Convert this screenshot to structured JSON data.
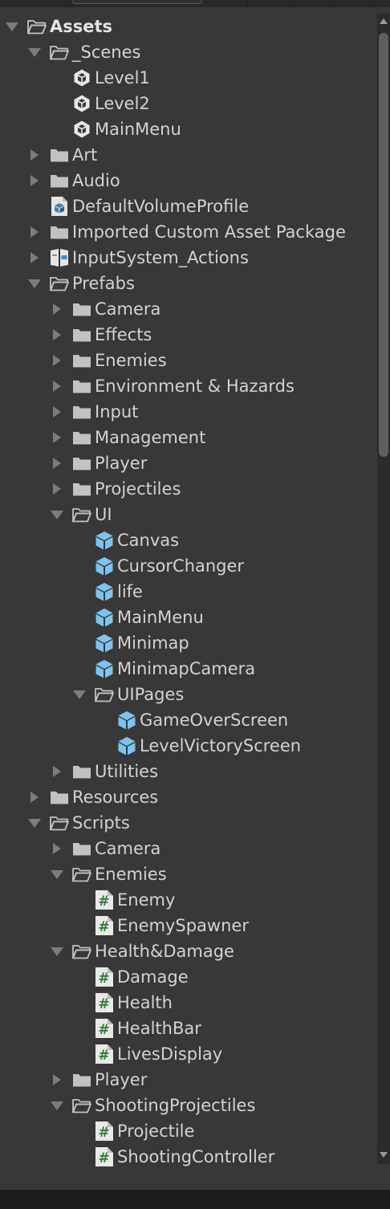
{
  "project_tree": {
    "items": [
      {
        "label": "Assets",
        "depth": 0,
        "icon": "folder-open-icon",
        "expand": "expanded",
        "bold": true
      },
      {
        "label": "_Scenes",
        "depth": 1,
        "icon": "folder-open-icon",
        "expand": "expanded"
      },
      {
        "label": "Level1",
        "depth": 2,
        "icon": "unity-scene-icon",
        "expand": "none"
      },
      {
        "label": "Level2",
        "depth": 2,
        "icon": "unity-scene-icon",
        "expand": "none"
      },
      {
        "label": "MainMenu",
        "depth": 2,
        "icon": "unity-scene-icon",
        "expand": "none"
      },
      {
        "label": "Art",
        "depth": 1,
        "icon": "folder-icon",
        "expand": "collapsed"
      },
      {
        "label": "Audio",
        "depth": 1,
        "icon": "folder-icon",
        "expand": "collapsed"
      },
      {
        "label": "DefaultVolumeProfile",
        "depth": 1,
        "icon": "volume-profile-icon",
        "expand": "none"
      },
      {
        "label": "Imported Custom Asset Package",
        "depth": 1,
        "icon": "folder-icon",
        "expand": "collapsed"
      },
      {
        "label": "InputSystem_Actions",
        "depth": 1,
        "icon": "input-actions-icon",
        "expand": "collapsed"
      },
      {
        "label": "Prefabs",
        "depth": 1,
        "icon": "folder-open-icon",
        "expand": "expanded"
      },
      {
        "label": "Camera",
        "depth": 2,
        "icon": "folder-icon",
        "expand": "collapsed"
      },
      {
        "label": "Effects",
        "depth": 2,
        "icon": "folder-icon",
        "expand": "collapsed"
      },
      {
        "label": "Enemies",
        "depth": 2,
        "icon": "folder-icon",
        "expand": "collapsed"
      },
      {
        "label": "Environment & Hazards",
        "depth": 2,
        "icon": "folder-icon",
        "expand": "collapsed"
      },
      {
        "label": "Input",
        "depth": 2,
        "icon": "folder-icon",
        "expand": "collapsed"
      },
      {
        "label": "Management",
        "depth": 2,
        "icon": "folder-icon",
        "expand": "collapsed"
      },
      {
        "label": "Player",
        "depth": 2,
        "icon": "folder-icon",
        "expand": "collapsed"
      },
      {
        "label": "Projectiles",
        "depth": 2,
        "icon": "folder-icon",
        "expand": "collapsed"
      },
      {
        "label": "UI",
        "depth": 2,
        "icon": "folder-open-icon",
        "expand": "expanded"
      },
      {
        "label": "Canvas",
        "depth": 3,
        "icon": "prefab-icon",
        "expand": "none"
      },
      {
        "label": "CursorChanger",
        "depth": 3,
        "icon": "prefab-icon",
        "expand": "none"
      },
      {
        "label": "life",
        "depth": 3,
        "icon": "prefab-icon",
        "expand": "none"
      },
      {
        "label": "MainMenu",
        "depth": 3,
        "icon": "prefab-icon",
        "expand": "none"
      },
      {
        "label": "Minimap",
        "depth": 3,
        "icon": "prefab-icon",
        "expand": "none"
      },
      {
        "label": "MinimapCamera",
        "depth": 3,
        "icon": "prefab-icon",
        "expand": "none"
      },
      {
        "label": "UIPages",
        "depth": 3,
        "icon": "folder-open-icon",
        "expand": "expanded"
      },
      {
        "label": "GameOverScreen",
        "depth": 4,
        "icon": "prefab-icon",
        "expand": "none"
      },
      {
        "label": "LevelVictoryScreen",
        "depth": 4,
        "icon": "prefab-icon",
        "expand": "none"
      },
      {
        "label": "Utilities",
        "depth": 2,
        "icon": "folder-icon",
        "expand": "collapsed"
      },
      {
        "label": "Resources",
        "depth": 1,
        "icon": "folder-icon",
        "expand": "collapsed"
      },
      {
        "label": "Scripts",
        "depth": 1,
        "icon": "folder-open-icon",
        "expand": "expanded"
      },
      {
        "label": "Camera",
        "depth": 2,
        "icon": "folder-icon",
        "expand": "collapsed"
      },
      {
        "label": "Enemies",
        "depth": 2,
        "icon": "folder-open-icon",
        "expand": "expanded"
      },
      {
        "label": "Enemy",
        "depth": 3,
        "icon": "csharp-script-icon",
        "expand": "none"
      },
      {
        "label": "EnemySpawner",
        "depth": 3,
        "icon": "csharp-script-icon",
        "expand": "none"
      },
      {
        "label": "Health&Damage",
        "depth": 2,
        "icon": "folder-open-icon",
        "expand": "expanded"
      },
      {
        "label": "Damage",
        "depth": 3,
        "icon": "csharp-script-icon",
        "expand": "none"
      },
      {
        "label": "Health",
        "depth": 3,
        "icon": "csharp-script-icon",
        "expand": "none"
      },
      {
        "label": "HealthBar",
        "depth": 3,
        "icon": "csharp-script-icon",
        "expand": "none"
      },
      {
        "label": "LivesDisplay",
        "depth": 3,
        "icon": "csharp-script-icon",
        "expand": "none"
      },
      {
        "label": "Player",
        "depth": 2,
        "icon": "folder-icon",
        "expand": "collapsed"
      },
      {
        "label": "ShootingProjectiles",
        "depth": 2,
        "icon": "folder-open-icon",
        "expand": "expanded"
      },
      {
        "label": "Projectile",
        "depth": 3,
        "icon": "csharp-script-icon",
        "expand": "none"
      },
      {
        "label": "ShootingController",
        "depth": 3,
        "icon": "csharp-script-icon",
        "expand": "none"
      }
    ]
  },
  "colors": {
    "background": "#383838",
    "text": "#d2d2d2",
    "prefab": "#7cc4ee",
    "script_bg": "#e9e9e9",
    "script_hash": "#2e7d32",
    "folder": "#c2c2c2"
  }
}
